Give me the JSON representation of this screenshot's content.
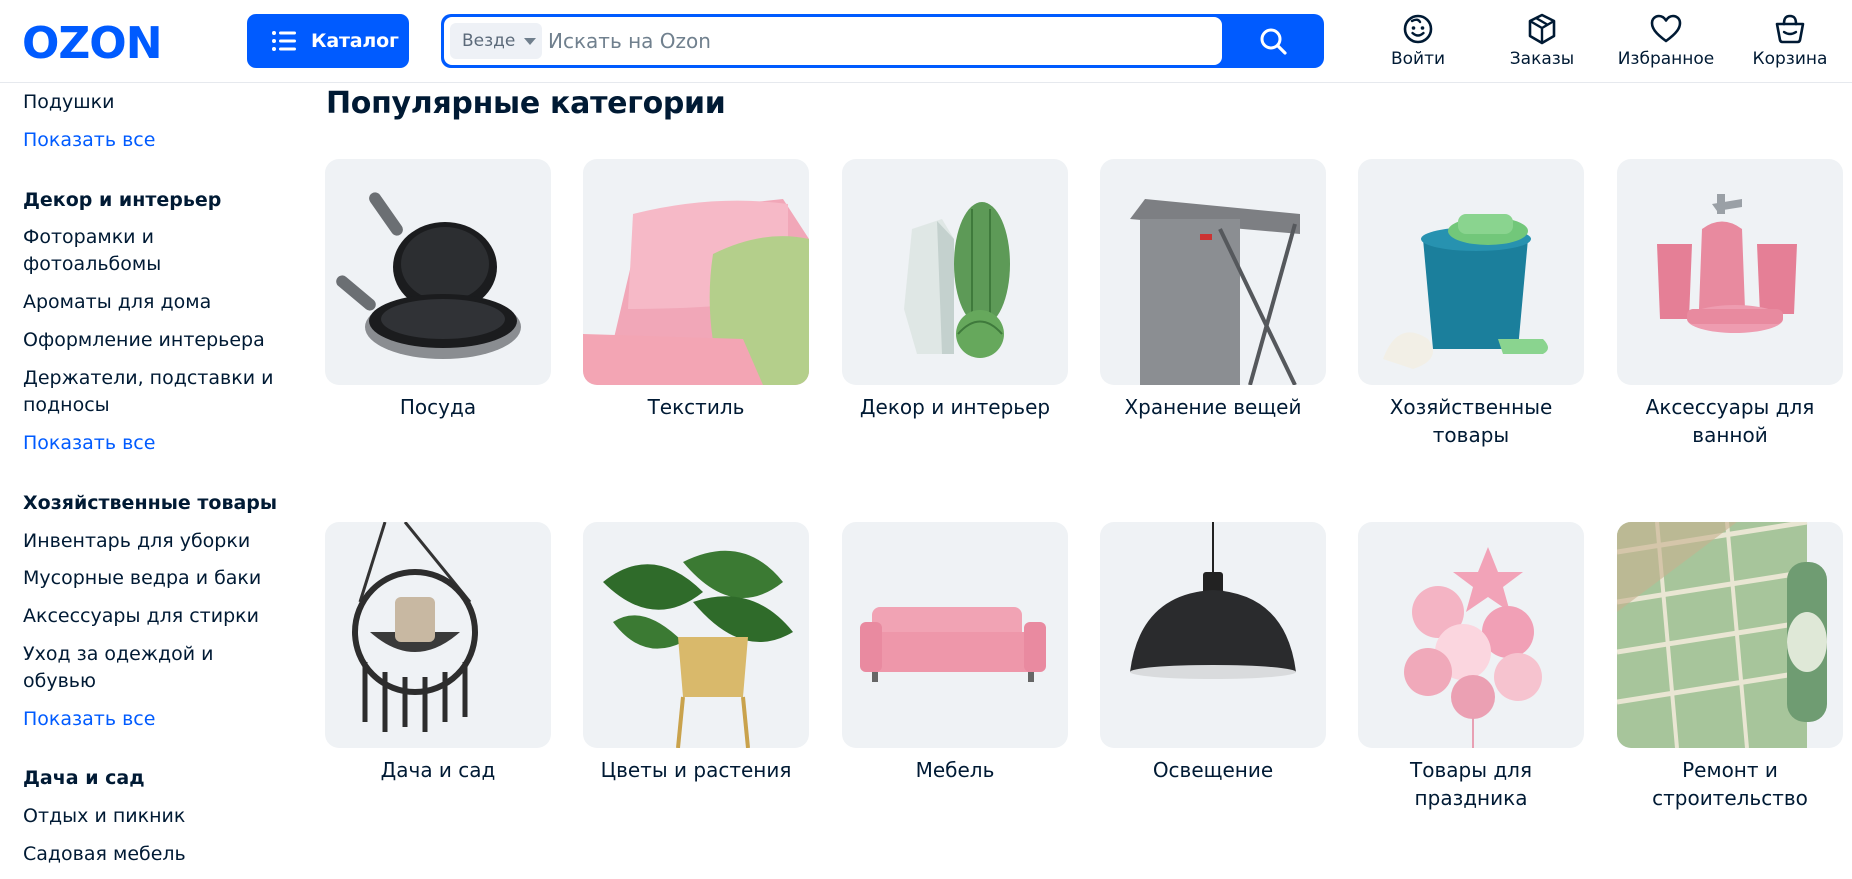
{
  "brand": {
    "logo_text": "OZON",
    "accent": "#005bff"
  },
  "header": {
    "catalog_label": "Каталог",
    "search": {
      "scope": "Везде",
      "placeholder": "Искать на Ozon"
    },
    "actions": [
      {
        "label": "Войти",
        "icon": "user-smile-icon"
      },
      {
        "label": "Заказы",
        "icon": "box-icon"
      },
      {
        "label": "Избранное",
        "icon": "heart-icon"
      },
      {
        "label": "Корзина",
        "icon": "cart-icon"
      }
    ]
  },
  "sidebar": {
    "top": {
      "item": "Подушки",
      "more": "Показать все"
    },
    "groups": [
      {
        "title": "Декор и интерьер",
        "items": [
          "Фоторамки и фотоальбомы",
          "Ароматы для дома",
          "Оформление интерьера",
          "Держатели, подставки и подносы"
        ],
        "more": "Показать все"
      },
      {
        "title": "Хозяйственные товары",
        "items": [
          "Инвентарь для уборки",
          "Мусорные ведра и баки",
          "Аксессуары для стирки",
          "Уход за одеждой и обувью"
        ],
        "more": "Показать все"
      },
      {
        "title": "Дача и сад",
        "items": [
          "Отдых и пикник",
          "Садовая мебель"
        ]
      }
    ]
  },
  "main": {
    "title": "Популярные категории",
    "categories": [
      {
        "label": "Посуда",
        "icon": "frying-pans-image"
      },
      {
        "label": "Текстиль",
        "icon": "pillows-image"
      },
      {
        "label": "Декор и интерьер",
        "icon": "cactus-vase-image"
      },
      {
        "label": "Хранение вещей",
        "icon": "laundry-hamper-image"
      },
      {
        "label": "Хозяйственные товары",
        "icon": "mop-bucket-image"
      },
      {
        "label": "Аксессуары для ванной",
        "icon": "bath-set-image"
      },
      {
        "label": "Дача и сад",
        "icon": "hanging-chair-image"
      },
      {
        "label": "Цветы и растения",
        "icon": "monstera-plant-image"
      },
      {
        "label": "Мебель",
        "icon": "pink-sofa-image"
      },
      {
        "label": "Освещение",
        "icon": "pendant-lamp-image"
      },
      {
        "label": "Товары для праздника",
        "icon": "balloons-image"
      },
      {
        "label": "Ремонт и строительство",
        "icon": "wallpaper-roll-image"
      }
    ]
  }
}
